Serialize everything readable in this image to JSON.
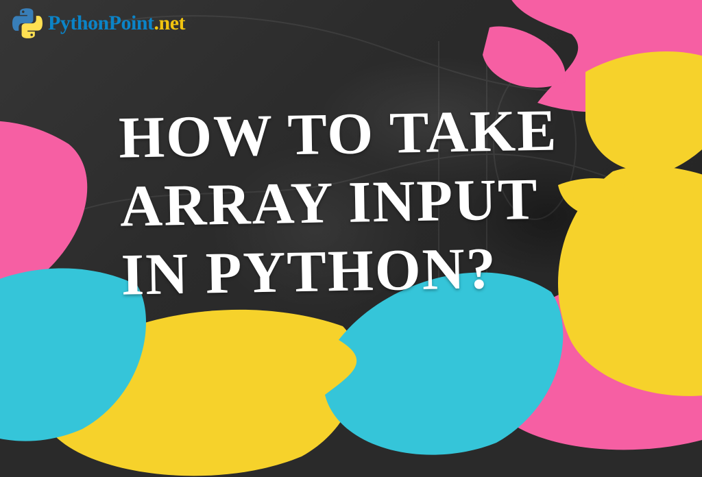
{
  "brand": {
    "name_part1": "PythonPoint",
    "name_part2": ".net"
  },
  "headline": {
    "line1": "HOW TO TAKE",
    "line2": "ARRAY INPUT",
    "line3": "IN PYTHON?"
  },
  "colors": {
    "pink": "#f65fa3",
    "yellow": "#f6d22b",
    "cyan": "#35c5d9",
    "text": "#ffffff",
    "brand_blue": "#0b84c8",
    "brand_yellow": "#f1c40f"
  }
}
